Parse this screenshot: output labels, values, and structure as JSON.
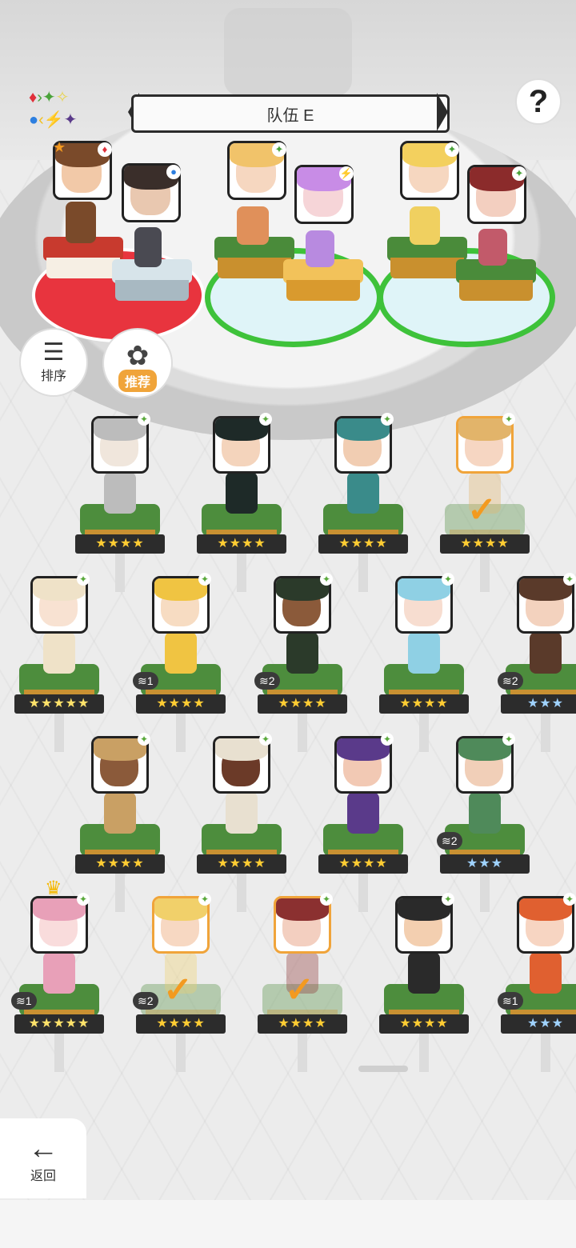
{
  "header": {
    "team_name": "队伍 E",
    "help_label": "?"
  },
  "element_legend": [
    "♦",
    "✦",
    "✧",
    "●",
    "⚡",
    "✦"
  ],
  "actions": {
    "sort_label": "排序",
    "recommend_label": "推荐"
  },
  "team": [
    {
      "name": "slot-1",
      "element": "fire",
      "elem_glyph": "♦",
      "star": true,
      "colors": [
        "#7a4a2a",
        "#f2c9a8"
      ]
    },
    {
      "name": "slot-2",
      "element": "water",
      "elem_glyph": "●",
      "colors": [
        "#3a2e2a",
        "#e9c8b0"
      ]
    },
    {
      "name": "slot-3",
      "element": "wood",
      "elem_glyph": "✦",
      "colors": [
        "#f1c36a",
        "#f6d7c0"
      ]
    },
    {
      "name": "slot-4",
      "element": "thunder",
      "elem_glyph": "⚡",
      "colors": [
        "#c88ce6",
        "#f6d5d8"
      ]
    },
    {
      "name": "slot-5",
      "element": "wood",
      "elem_glyph": "✦",
      "colors": [
        "#f3d05e",
        "#f6d7c0"
      ]
    },
    {
      "name": "slot-6",
      "element": "wood",
      "elem_glyph": "✦",
      "colors": [
        "#8b2b2b",
        "#f3cfc0"
      ]
    }
  ],
  "roster": [
    {
      "row": 0,
      "stars": "★★★★",
      "color": "#bcbcbc",
      "skin": "#f0e6dc",
      "level": "",
      "selected": false
    },
    {
      "row": 0,
      "stars": "★★★★",
      "color": "#1e2a28",
      "skin": "#f4d4bc",
      "level": "",
      "selected": false
    },
    {
      "row": 0,
      "stars": "★★★★",
      "color": "#3a8b8a",
      "skin": "#f1cdb2",
      "level": "",
      "selected": false
    },
    {
      "row": 0,
      "stars": "★★★★",
      "color": "#e2b46a",
      "skin": "#f6d6c2",
      "level": "",
      "selected": true
    },
    {
      "row": 1,
      "stars": "★★★★★",
      "color": "#efe2c8",
      "skin": "#f8e2d2",
      "level": "",
      "selected": false
    },
    {
      "row": 1,
      "stars": "★★★★",
      "color": "#f0c442",
      "skin": "#f7dcc2",
      "level": "1",
      "selected": false
    },
    {
      "row": 1,
      "stars": "★★★★",
      "color": "#2b3a2a",
      "skin": "#8b5a3a",
      "level": "2",
      "selected": false
    },
    {
      "row": 1,
      "stars": "★★★★",
      "color": "#8fd0e4",
      "skin": "#f7ddd0",
      "level": "",
      "selected": false
    },
    {
      "row": 1,
      "stars": "★★★",
      "color": "#5a3a2a",
      "skin": "#f3d2be",
      "level": "2",
      "selected": false
    },
    {
      "row": 2,
      "stars": "★★★★",
      "color": "#c9a064",
      "skin": "#8b5a3a",
      "level": "",
      "selected": false
    },
    {
      "row": 2,
      "stars": "★★★★",
      "color": "#e8e0d0",
      "skin": "#6b3a28",
      "level": "",
      "selected": false
    },
    {
      "row": 2,
      "stars": "★★★★",
      "color": "#5a3a8a",
      "skin": "#f2c9b4",
      "level": "",
      "selected": false
    },
    {
      "row": 2,
      "stars": "★★★",
      "color": "#4f8a5a",
      "skin": "#f1cfb8",
      "level": "2",
      "selected": false
    },
    {
      "row": 3,
      "stars": "★★★★★",
      "color": "#e8a0b8",
      "skin": "#f9dcdc",
      "level": "1",
      "selected": false
    },
    {
      "row": 3,
      "stars": "★★★★",
      "color": "#f1d06a",
      "skin": "#f7d8c2",
      "level": "2",
      "selected": true
    },
    {
      "row": 3,
      "stars": "★★★★",
      "color": "#8b3030",
      "skin": "#f3cfc0",
      "level": "",
      "selected": true
    },
    {
      "row": 3,
      "stars": "★★★★",
      "color": "#2a2a2a",
      "skin": "#f3cfb0",
      "level": "",
      "selected": false
    },
    {
      "row": 3,
      "stars": "★★★",
      "color": "#e06030",
      "skin": "#f7d5c2",
      "level": "1",
      "selected": false
    }
  ],
  "footer": {
    "back_label": "返回"
  }
}
